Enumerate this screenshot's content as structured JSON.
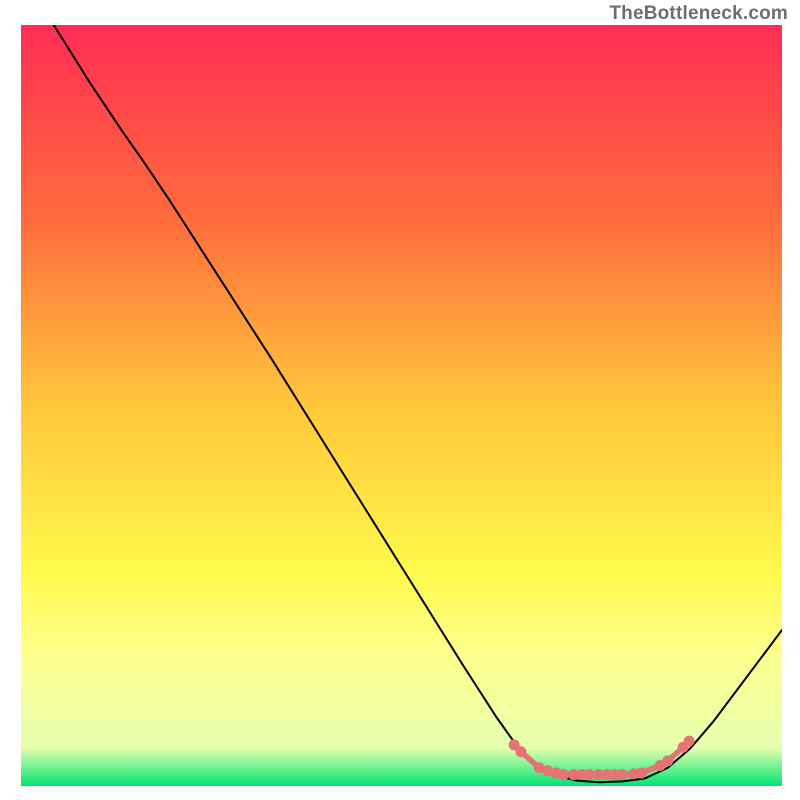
{
  "attribution": "TheBottleneck.com",
  "chart_data": {
    "type": "line",
    "title": "",
    "xlabel": "",
    "ylabel": "",
    "xlim": [
      0,
      100
    ],
    "ylim": [
      0,
      100
    ],
    "gradient_stops": [
      {
        "offset": 0,
        "color": "#ff2d55"
      },
      {
        "offset": 25,
        "color": "#ff6a3c"
      },
      {
        "offset": 50,
        "color": "#ffc63b"
      },
      {
        "offset": 72,
        "color": "#fff94c"
      },
      {
        "offset": 82,
        "color": "#ffff8a"
      },
      {
        "offset": 95,
        "color": "#e6ffb0"
      },
      {
        "offset": 100,
        "color": "#00e472"
      }
    ],
    "series": [
      {
        "name": "bottleneck-curve",
        "stroke": "#000000",
        "stroke_width": 2,
        "points": [
          {
            "x": 4.3,
            "y": 100.0
          },
          {
            "x": 6.5,
            "y": 96.5
          },
          {
            "x": 9.0,
            "y": 92.5
          },
          {
            "x": 11.0,
            "y": 89.5
          },
          {
            "x": 13.2,
            "y": 86.2
          },
          {
            "x": 16.0,
            "y": 82.2
          },
          {
            "x": 19.5,
            "y": 77.0
          },
          {
            "x": 24.0,
            "y": 70.0
          },
          {
            "x": 28.5,
            "y": 63.0
          },
          {
            "x": 33.0,
            "y": 56.0
          },
          {
            "x": 38.0,
            "y": 48.0
          },
          {
            "x": 43.0,
            "y": 40.0
          },
          {
            "x": 48.0,
            "y": 32.0
          },
          {
            "x": 53.0,
            "y": 24.0
          },
          {
            "x": 58.0,
            "y": 16.0
          },
          {
            "x": 62.5,
            "y": 9.0
          },
          {
            "x": 65.0,
            "y": 5.5
          },
          {
            "x": 67.5,
            "y": 3.0
          },
          {
            "x": 70.0,
            "y": 1.5
          },
          {
            "x": 73.0,
            "y": 0.7
          },
          {
            "x": 76.0,
            "y": 0.5
          },
          {
            "x": 79.0,
            "y": 0.6
          },
          {
            "x": 82.0,
            "y": 1.0
          },
          {
            "x": 85.0,
            "y": 2.4
          },
          {
            "x": 88.0,
            "y": 5.0
          },
          {
            "x": 91.0,
            "y": 8.5
          },
          {
            "x": 94.0,
            "y": 12.5
          },
          {
            "x": 97.0,
            "y": 16.5
          },
          {
            "x": 100.0,
            "y": 20.5
          }
        ]
      },
      {
        "name": "valley-markers",
        "stroke": "#e57373",
        "marker_fill": "#e57373",
        "marker_radius": 5.5,
        "segment_width": 5.5,
        "points": [
          {
            "x": 64.8,
            "y": 5.4
          },
          {
            "x": 65.7,
            "y": 4.5
          },
          {
            "x": 68.1,
            "y": 2.4
          },
          {
            "x": 69.2,
            "y": 2.0
          },
          {
            "x": 70.3,
            "y": 1.7
          },
          {
            "x": 71.3,
            "y": 1.5
          },
          {
            "x": 72.6,
            "y": 1.5
          },
          {
            "x": 73.7,
            "y": 1.5
          },
          {
            "x": 74.7,
            "y": 1.5
          },
          {
            "x": 75.9,
            "y": 1.5
          },
          {
            "x": 77.0,
            "y": 1.5
          },
          {
            "x": 78.0,
            "y": 1.5
          },
          {
            "x": 79.0,
            "y": 1.5
          },
          {
            "x": 80.5,
            "y": 1.6
          },
          {
            "x": 81.5,
            "y": 1.7
          },
          {
            "x": 84.0,
            "y": 2.7
          },
          {
            "x": 85.0,
            "y": 3.3
          },
          {
            "x": 87.0,
            "y": 5.1
          },
          {
            "x": 87.8,
            "y": 5.9
          }
        ]
      }
    ]
  }
}
